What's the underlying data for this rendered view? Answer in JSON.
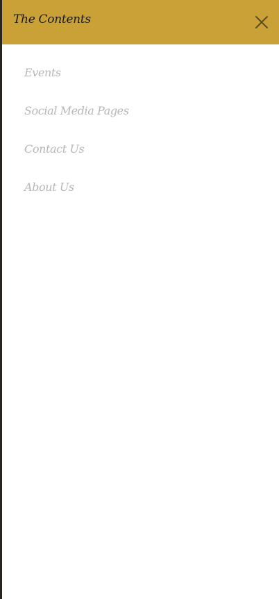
{
  "drawer": {
    "title": "The Contents",
    "close_icon": "close-icon",
    "accent_color": "#c9a136"
  },
  "nav": {
    "items": [
      {
        "label": "Events"
      },
      {
        "label": "Social Media Pages"
      },
      {
        "label": "Contact Us"
      },
      {
        "label": "About Us"
      }
    ]
  }
}
